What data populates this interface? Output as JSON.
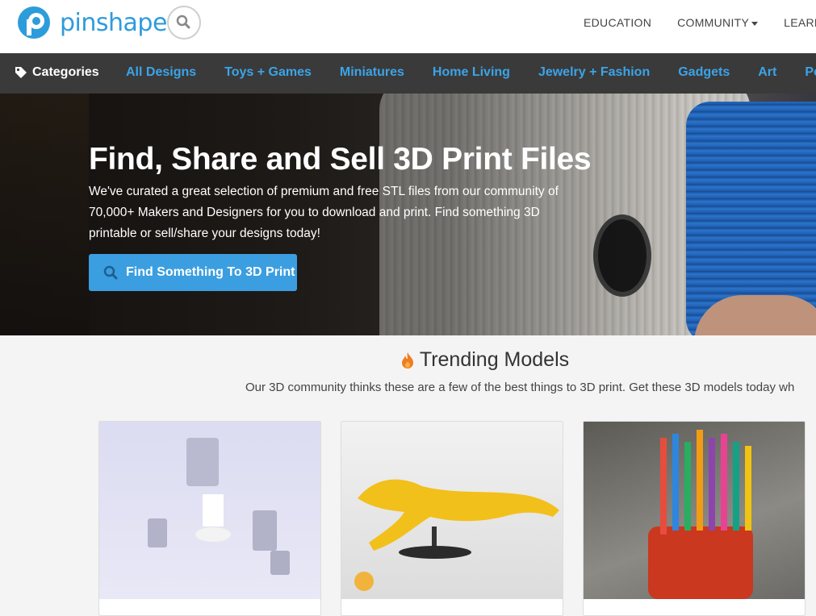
{
  "header": {
    "logo_text": "pinshape",
    "nav": [
      {
        "label": "EDUCATION"
      },
      {
        "label": "COMMUNITY"
      },
      {
        "label": "LEARN"
      }
    ]
  },
  "categories": {
    "label": "Categories",
    "items": [
      "All Designs",
      "Toys + Games",
      "Miniatures",
      "Home Living",
      "Jewelry + Fashion",
      "Gadgets",
      "Art",
      "People +"
    ]
  },
  "hero": {
    "title": "Find, Share and Sell 3D Print Files",
    "text": "We've curated a great selection of premium and free STL files from our community of 70,000+ Makers and Designers for you to download and print. Find something 3D printable or sell/share your designs today!",
    "button_label": "Find Something To 3D Print"
  },
  "trending": {
    "title": "Trending Models",
    "subtitle": "Our 3D community thinks these are a few of the best things to 3D print. Get these 3D models today wh"
  },
  "colors": {
    "brand_blue": "#2d9cdb",
    "category_link": "#3ba4e8",
    "button_blue": "#3b9ee0",
    "flame_orange": "#f07d22",
    "category_bar": "#3a3a3a"
  },
  "icons": [
    "logo-mark",
    "search-icon",
    "tag-icon",
    "magnifier-icon",
    "flame-icon",
    "robot-badge-icon"
  ]
}
